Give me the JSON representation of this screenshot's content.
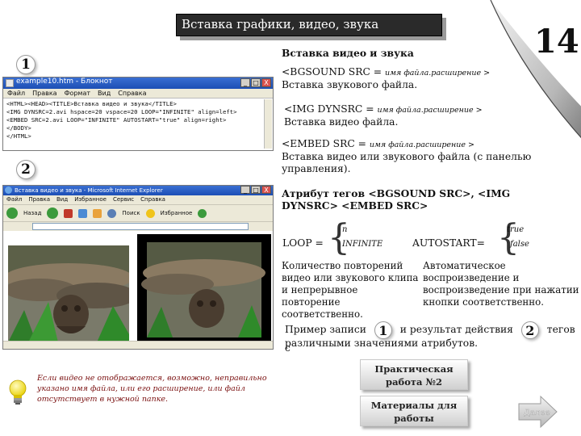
{
  "title": "Вставка графики, видео, звука",
  "page_number": "14",
  "badges": {
    "one": "1",
    "two": "2"
  },
  "notepad": {
    "title": "example10.htm - Блокнот",
    "menu": [
      "Файл",
      "Правка",
      "Формат",
      "Вид",
      "Справка"
    ],
    "lines": [
      "<HTML><HEAD><TITLE>Вставка видео и звука</TITLE>",
      "<IMG DYNSRC=2.avi hspace=20 vspace=20 LOOP=\"INFINITE\" align=left>",
      "<EMBED SRC=2.avi LOOP=\"INFINITE\" AUTOSTART=\"true\" align=right>",
      "</BODY>",
      "</HTML>"
    ],
    "window_buttons": [
      "_",
      "□",
      "X"
    ]
  },
  "ie": {
    "title": "Вставка видео и звука - Microsoft Internet Explorer",
    "menu": [
      "Файл",
      "Правка",
      "Вид",
      "Избранное",
      "Сервис",
      "Справка"
    ],
    "toolbar": {
      "back": "Назад",
      "search": "Поиск",
      "favorites": "Избранное"
    },
    "window_buttons": [
      "_",
      "□",
      "X"
    ]
  },
  "right": {
    "heading": "Вставка видео и звука",
    "bgsound_code": "<BGSOUND SRC =",
    "bgsound_italic": "имя файла.расширение >",
    "bgsound_desc": "Вставка звукового файла.",
    "img_code": "<IMG DYNSRC =",
    "img_italic": "имя файла.расширение >",
    "img_desc": "Вставка видео файла.",
    "embed_code": "<EMBED SRC =",
    "embed_italic": "имя файла.расширение >",
    "embed_desc": "Вставка видео или звукового файла (с панелью управления).",
    "attr_heading": "Атрибут тегов <BGSOUND SRC>, <IMG DYNSRC> <EMBED SRC>",
    "loop_label": "LOOP =",
    "loop_top": "n",
    "loop_bottom": "INFINITE",
    "autostart_label": "AUTOSTART=",
    "autostart_top": "true",
    "autostart_bottom": "false",
    "loop_desc": "Количество повторений видео или звукового клипа и непрерывное повторение соответственно.",
    "autostart_desc": "Автоматическое воспроизведение и воспроизведение при нажатии кнопки соответственно.",
    "example_part1": "Пример записи",
    "example_part2": "и результат действия",
    "example_part3": "тегов с",
    "example_part4": "различными значениями атрибутов."
  },
  "note": "Если видео не отображается, возможно, неправильно указано имя файла, или его расширение, или файл отсутствует в нужной папке.",
  "buttons": {
    "practical": "Практическая работа №2",
    "materials": "Материалы для работы",
    "next": "Далее"
  },
  "colors": {
    "title_bg": "#2a2a2a",
    "note_text": "#7a1010",
    "xp_blue": "#1c4eb5"
  }
}
